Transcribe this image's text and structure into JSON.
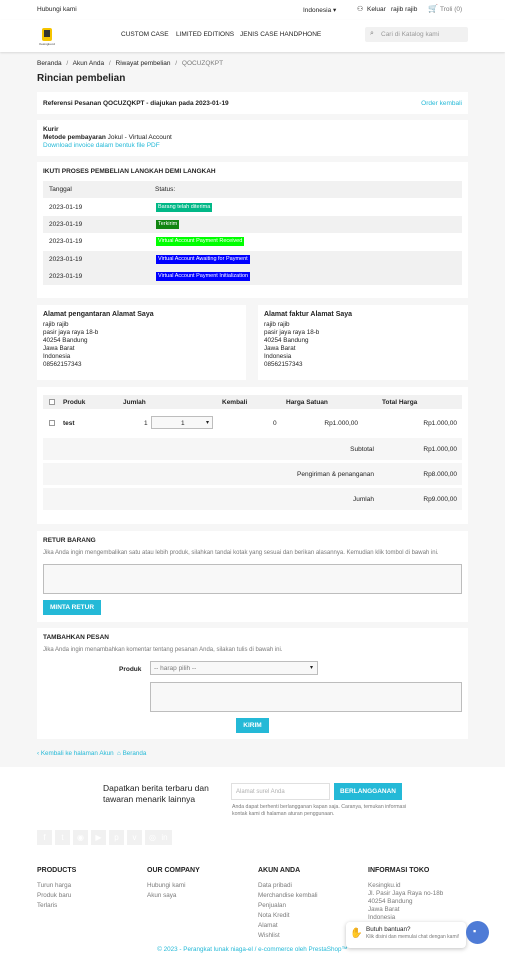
{
  "topbar": {
    "contact": "Hubungi kami",
    "language": "Indonesia",
    "logout": "Keluar",
    "user": "rajib rajib",
    "cart": "Troli (0)"
  },
  "header": {
    "logo_text": "Kesingku.id",
    "nav": [
      "CUSTOM CASE",
      "LIMITED EDITIONS",
      "JENIS CASE HANDPHONE"
    ],
    "search_placeholder": "Cari di Katalog kami"
  },
  "breadcrumb": [
    "Beranda",
    "Akun Anda",
    "Riwayat pembelian",
    "QOCUZQKPT"
  ],
  "page_title": "Rincian pembelian",
  "order_ref": {
    "text": "Referensi Pesanan QOCUZQKPT - diajukan pada 2023-01-19",
    "reorder": "Order kembali"
  },
  "carrier": {
    "label": "Kurir",
    "payment_label": "Metode pembayaran",
    "payment_value": "Jokul - Virtual Account",
    "invoice_link": "Download invoice dalam bentuk file PDF"
  },
  "steps": {
    "title": "IKUTI PROSES PEMBELIAN LANGKAH DEMI LANGKAH",
    "col_date": "Tanggal",
    "col_status": "Status:",
    "rows": [
      {
        "date": "2023-01-19",
        "status": "Barang telah diterima",
        "color": "#01b887"
      },
      {
        "date": "2023-01-19",
        "status": "Terkirim",
        "color": "#108510"
      },
      {
        "date": "2023-01-19",
        "status": "Virtual Account Payment Received",
        "color": "#00ff00"
      },
      {
        "date": "2023-01-19",
        "status": "Virtual Account Awaiting for Payment",
        "color": "#0000ff"
      },
      {
        "date": "2023-01-19",
        "status": "Virtual Account Payment Initialization",
        "color": "#0000ff"
      }
    ]
  },
  "delivery_address": {
    "title": "Alamat pengantaran Alamat Saya",
    "lines": [
      "rajib rajib",
      "pasir jaya raya 18-b",
      "40254 Bandung",
      "Jawa Barat",
      "Indonesia",
      "08562157343"
    ]
  },
  "invoice_address": {
    "title": "Alamat faktur Alamat Saya",
    "lines": [
      "rajib rajib",
      "pasir jaya raya 18-b",
      "40254 Bandung",
      "Jawa Barat",
      "Indonesia",
      "08562157343"
    ]
  },
  "products": {
    "headers": {
      "product": "Produk",
      "qty": "Jumlah",
      "returned": "Kembali",
      "unit_price": "Harga Satuan",
      "total": "Total Harga"
    },
    "row": {
      "name": "test",
      "qty": "1",
      "select_qty": "1",
      "returned": "0",
      "unit_price": "Rp1.000,00",
      "total": "Rp1.000,00"
    },
    "subtotal_label": "Subtotal",
    "subtotal": "Rp1.000,00",
    "shipping_label": "Pengiriman & penanganan",
    "shipping": "Rp8.000,00",
    "total_label": "Jumlah",
    "total": "Rp9.000,00"
  },
  "returns": {
    "title": "RETUR BARANG",
    "desc": "Jika Anda ingin mengembalikan satu atau lebih produk, silahkan tandai kotak yang sesuai dan berikan alasannya. Kemudian klik tombol di bawah ini.",
    "button": "MINTA RETUR"
  },
  "message": {
    "title": "TAMBAHKAN PESAN",
    "desc": "Jika Anda ingin menambahkan komentar tentang pesanan Anda, silakan tulis di bawah ini.",
    "product_label": "Produk",
    "select_placeholder": "-- harap pilih --",
    "button": "KIRIM"
  },
  "bottom_links": {
    "back": "Kembali ke halaman Akun",
    "home": "Beranda"
  },
  "newsletter": {
    "title": "Dapatkan berita terbaru dan tawaran menarik lainnya",
    "placeholder": "Alamat surel Anda",
    "button": "BERLANGGANAN",
    "note": "Anda dapat berhenti berlangganan kapan saja. Caranya, temukan informasi kontak kami di halaman aturan penggunaan."
  },
  "footer": {
    "products": {
      "title": "PRODUCTS",
      "items": [
        "Turun harga",
        "Produk baru",
        "Terlaris"
      ]
    },
    "company": {
      "title": "OUR COMPANY",
      "items": [
        "Hubungi kami",
        "Akun saya"
      ]
    },
    "account": {
      "title": "AKUN ANDA",
      "items": [
        "Data pribadi",
        "Merchandise kembali",
        "Penjualan",
        "Nota Kredit",
        "Alamat",
        "Wishlist"
      ]
    },
    "store": {
      "title": "INFORMASI TOKO",
      "items": [
        "Kesingku.id",
        "Jl. Pasir Jaya Raya no-18b",
        "40254 Bandung",
        "Jawa Barat",
        "Indonesia"
      ]
    },
    "copyright": "© 2023 - Perangkat lunak niaga-el / e-commerce oleh PrestaShop™"
  },
  "chat": {
    "title": "Butuh bantuan?",
    "subtitle": "Klik disini dan memulai chat dengan kami!"
  }
}
